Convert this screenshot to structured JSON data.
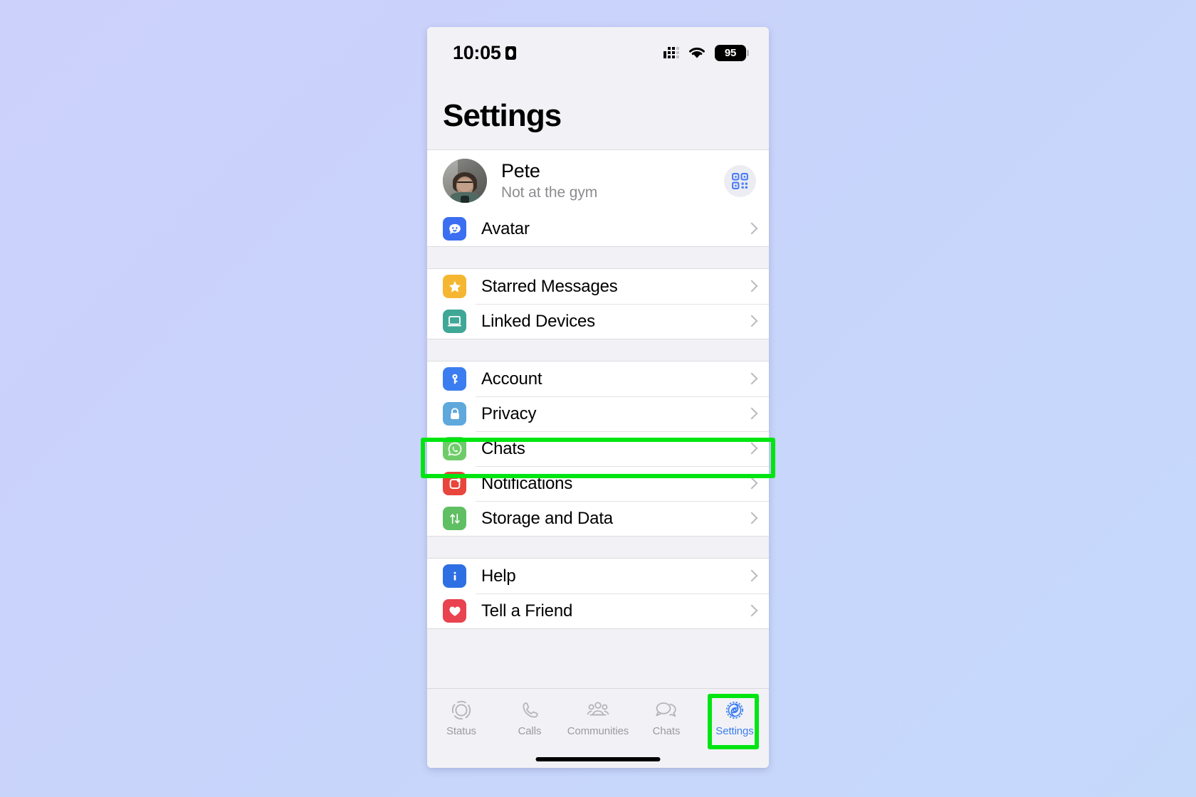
{
  "background": {
    "from": "#ccd1fb",
    "to": "#c5d9fb"
  },
  "status_bar": {
    "time": "10:05",
    "location_icon": "location-arrow-icon",
    "signal_icon": "cellular-signal-icon",
    "wifi_icon": "wifi-icon",
    "battery_level": "95"
  },
  "header": {
    "title": "Settings"
  },
  "profile": {
    "name": "Pete",
    "status": "Not at the gym",
    "avatar_icon": "profile-photo",
    "qr_icon": "qr-code-icon"
  },
  "sections": [
    {
      "id": "avatar-section",
      "rows": [
        {
          "id": "avatar",
          "label": "Avatar",
          "icon": "avatar-icon",
          "icon_color": "#3b6ef0"
        }
      ]
    },
    {
      "id": "messages-section",
      "rows": [
        {
          "id": "starred-messages",
          "label": "Starred Messages",
          "icon": "star-icon",
          "icon_color": "#f5b731"
        },
        {
          "id": "linked-devices",
          "label": "Linked Devices",
          "icon": "laptop-icon",
          "icon_color": "#3fa795"
        }
      ]
    },
    {
      "id": "preferences-section",
      "rows": [
        {
          "id": "account",
          "label": "Account",
          "icon": "key-icon",
          "icon_color": "#3b7df0"
        },
        {
          "id": "privacy",
          "label": "Privacy",
          "icon": "lock-icon",
          "icon_color": "#5fa8dc"
        },
        {
          "id": "chats",
          "label": "Chats",
          "icon": "whatsapp-chat-icon",
          "icon_color": "#6fcb6a",
          "highlighted": true
        },
        {
          "id": "notifications",
          "label": "Notifications",
          "icon": "bell-notification-icon",
          "icon_color": "#e8453c"
        },
        {
          "id": "storage-and-data",
          "label": "Storage and Data",
          "icon": "arrows-updown-icon",
          "icon_color": "#5fbf62"
        }
      ]
    },
    {
      "id": "support-section",
      "rows": [
        {
          "id": "help",
          "label": "Help",
          "icon": "info-icon",
          "icon_color": "#2f6fe4"
        },
        {
          "id": "tell-a-friend",
          "label": "Tell a Friend",
          "icon": "heart-icon",
          "icon_color": "#e8434f"
        }
      ]
    }
  ],
  "tab_bar": {
    "active": "settings",
    "active_color": "#3b7df0",
    "inactive_color": "#9a9aa0",
    "tabs": [
      {
        "id": "status",
        "label": "Status",
        "icon": "status-rings-icon"
      },
      {
        "id": "calls",
        "label": "Calls",
        "icon": "phone-icon"
      },
      {
        "id": "communities",
        "label": "Communities",
        "icon": "communities-people-icon"
      },
      {
        "id": "chats",
        "label": "Chats",
        "icon": "chat-bubbles-icon"
      },
      {
        "id": "settings",
        "label": "Settings",
        "icon": "gear-icon"
      }
    ]
  },
  "annotations": {
    "color": "#00e512",
    "boxes": [
      {
        "id": "chats-row-highlight",
        "target": "chats"
      },
      {
        "id": "settings-tab-highlight",
        "target": "settings"
      }
    ]
  }
}
